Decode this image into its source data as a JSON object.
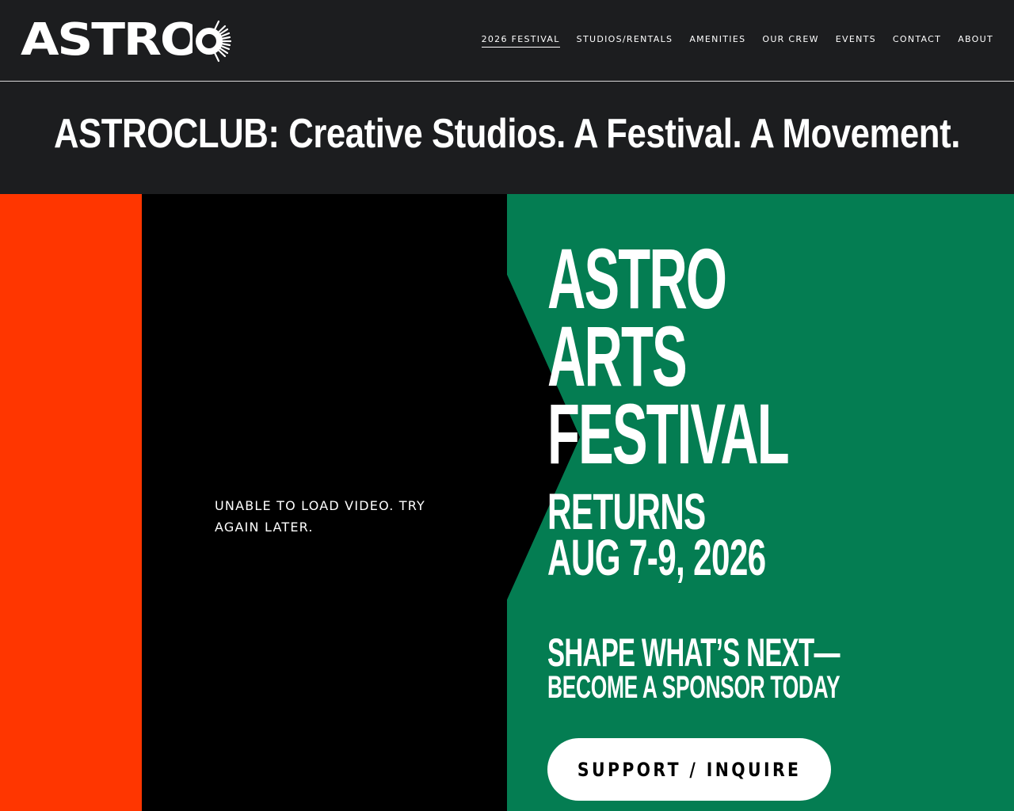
{
  "header": {
    "logo_text": "ASTRO",
    "nav": [
      {
        "label": "2026 FESTIVAL",
        "active": true
      },
      {
        "label": "STUDIOS/RENTALS",
        "active": false
      },
      {
        "label": "AMENITIES",
        "active": false
      },
      {
        "label": "OUR CREW",
        "active": false
      },
      {
        "label": "EVENTS",
        "active": false
      },
      {
        "label": "CONTACT",
        "active": false
      },
      {
        "label": "ABOUT",
        "active": false
      }
    ]
  },
  "banner": {
    "tagline": "ASTROCLUB: Creative Studios. A Festival. A Movement."
  },
  "hero": {
    "video_error": "UNABLE TO LOAD VIDEO. TRY AGAIN LATER.",
    "title_lines": [
      "ASTRO",
      "ARTS",
      "FESTIVAL"
    ],
    "returns_lines": [
      "RETURNS",
      "AUG 7-9, 2026"
    ],
    "sponsor_line1": "SHAPE WHAT’S NEXT—",
    "sponsor_line2": "BECOME A SPONSOR TODAY",
    "cta_label": "SUPPORT / INQUIRE"
  },
  "colors": {
    "header_bg": "#1c1d1f",
    "orange": "#ff3600",
    "green": "#047d52",
    "video_bg": "#000000",
    "text": "#ffffff"
  }
}
